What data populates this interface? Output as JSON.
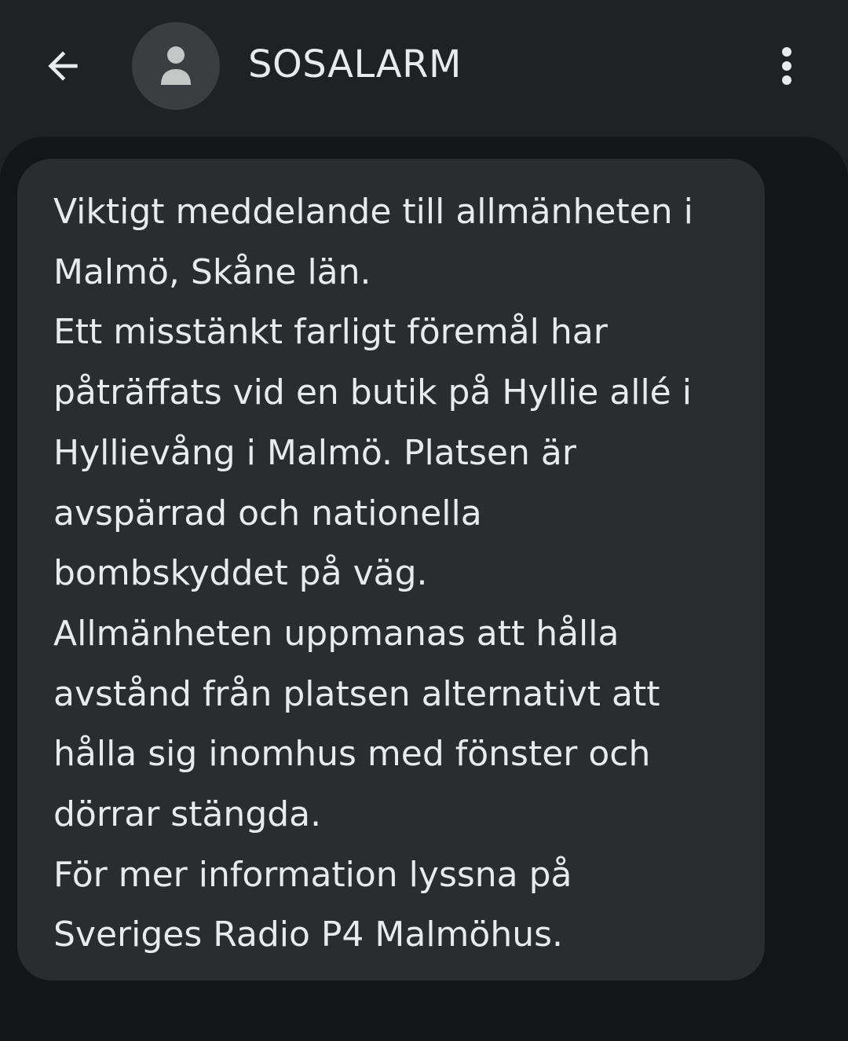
{
  "header": {
    "back_icon": "arrow-left-icon",
    "avatar_icon": "person-icon",
    "contact_name": "SOSALARM",
    "more_icon": "more-vert-icon"
  },
  "message": {
    "lines": [
      "Viktigt meddelande till allmänheten i",
      "Malmö, Skåne län.",
      "Ett misstänkt farligt föremål har",
      "påträffats vid en butik på Hyllie allé i",
      "Hyllievång i Malmö. Platsen är",
      "avspärrad och nationella",
      "bombskyddet på väg.",
      "Allmänheten uppmanas att hålla",
      "avstånd från platsen alternativt att",
      "hålla sig inomhus med fönster och",
      "dörrar stängda.",
      "För mer information lyssna på",
      "Sveriges Radio P4 Malmöhus."
    ]
  },
  "colors": {
    "background": "#202124",
    "conversation_background": "#141517",
    "bubble": "#2b2c2f",
    "text": "#e8eaed",
    "avatar": "#3c3d40",
    "avatar_glyph": "#c4c7c5"
  }
}
